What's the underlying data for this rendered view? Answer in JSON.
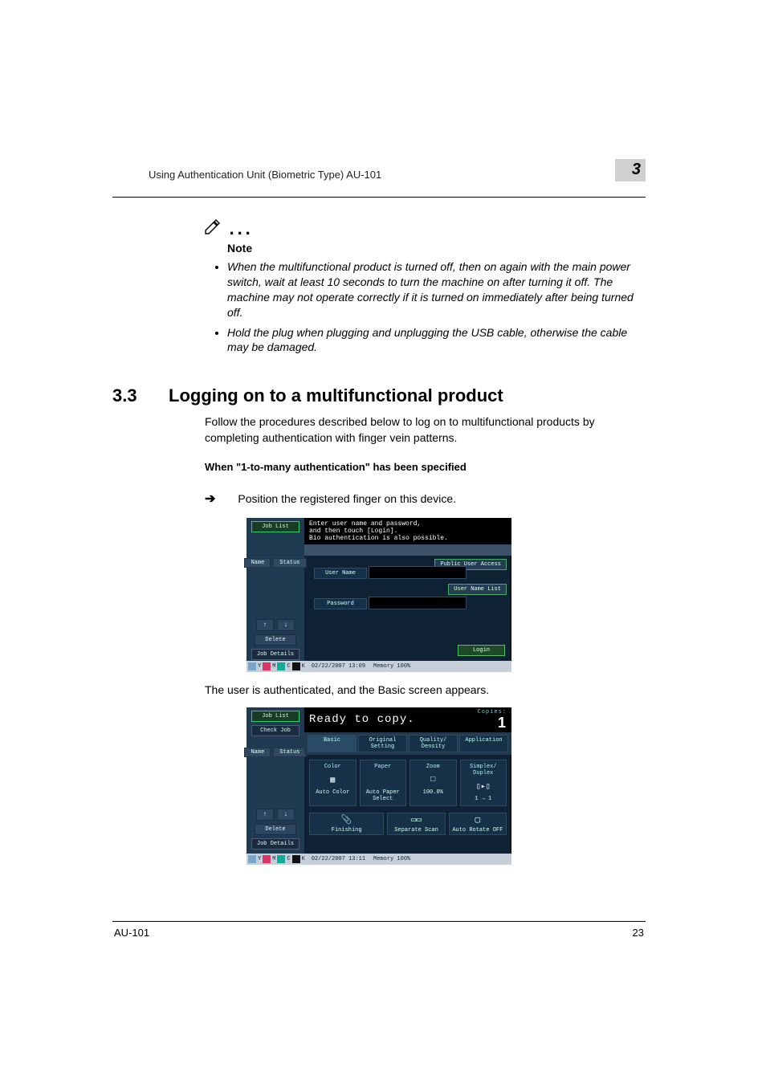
{
  "running_head": "Using Authentication Unit (Biometric Type) AU-101",
  "chapter_badge": "3",
  "note": {
    "label": "Note",
    "items": [
      "When the multifunctional product is turned off, then on again with the main power switch, wait at least 10 seconds to turn the machine on after turning it off. The machine may not operate correctly if it is turned on immediately after being turned off.",
      "Hold the plug when plugging and unplugging the USB cable, otherwise the cable may be damaged."
    ]
  },
  "section": {
    "number": "3.3",
    "title": "Logging on to a multifunctional product",
    "intro": "Follow the procedures described below to log on to multifunctional products by completing authentication with finger vein patterns.",
    "sub_heading": "When \"1-to-many authentication\" has been specified",
    "step_arrow": "➔",
    "step_text": "Position the registered finger on this device."
  },
  "shot1": {
    "sidebar": {
      "job_list": "Job List",
      "user_name_col": "Name",
      "status_col": "Status",
      "up": "↑",
      "down": "↓",
      "delete": "Delete",
      "details": "Job Details"
    },
    "banner_line1": "Enter user name and password,",
    "banner_line2": "and then touch [Login].",
    "banner_line3": "Bio authentication is also possible.",
    "public_user": "Public User Access",
    "user_name_lbl": "User Name",
    "user_name_list": "User Name List",
    "password_lbl": "Password",
    "login": "Login",
    "status_y": "Y",
    "status_m": "M",
    "status_c": "C",
    "status_k": "K",
    "datetime": "02/22/2007   13:09",
    "memory": "Memory      100%"
  },
  "after_shot1": "The user is authenticated, and the Basic screen appears.",
  "shot2": {
    "sidebar": {
      "job_list": "Job List",
      "check_job": "Check Job",
      "user_name_col": "Name",
      "status_col": "Status",
      "up": "↑",
      "down": "↓",
      "delete": "Delete",
      "details": "Job Details"
    },
    "title": "Ready to copy.",
    "copies_label": "Copies:",
    "copies_value": "1",
    "tabs": [
      "Basic",
      "Original Setting",
      "Quality/\nDensity",
      "Application"
    ],
    "cards": [
      {
        "cap": "Color",
        "val": "Auto Color"
      },
      {
        "cap": "Paper",
        "val": "Auto Paper\nSelect"
      },
      {
        "cap": "Zoom",
        "val": "100.0%"
      },
      {
        "cap": "Simplex/\nDuplex",
        "val": "1 → 1"
      }
    ],
    "bottom": [
      {
        "label": "Finishing"
      },
      {
        "label": "Separate Scan"
      },
      {
        "label": "Auto Rotate OFF"
      }
    ],
    "datetime": "02/22/2007   13:11",
    "memory": "Memory      100%"
  },
  "footer": {
    "left": "AU-101",
    "right": "23"
  }
}
